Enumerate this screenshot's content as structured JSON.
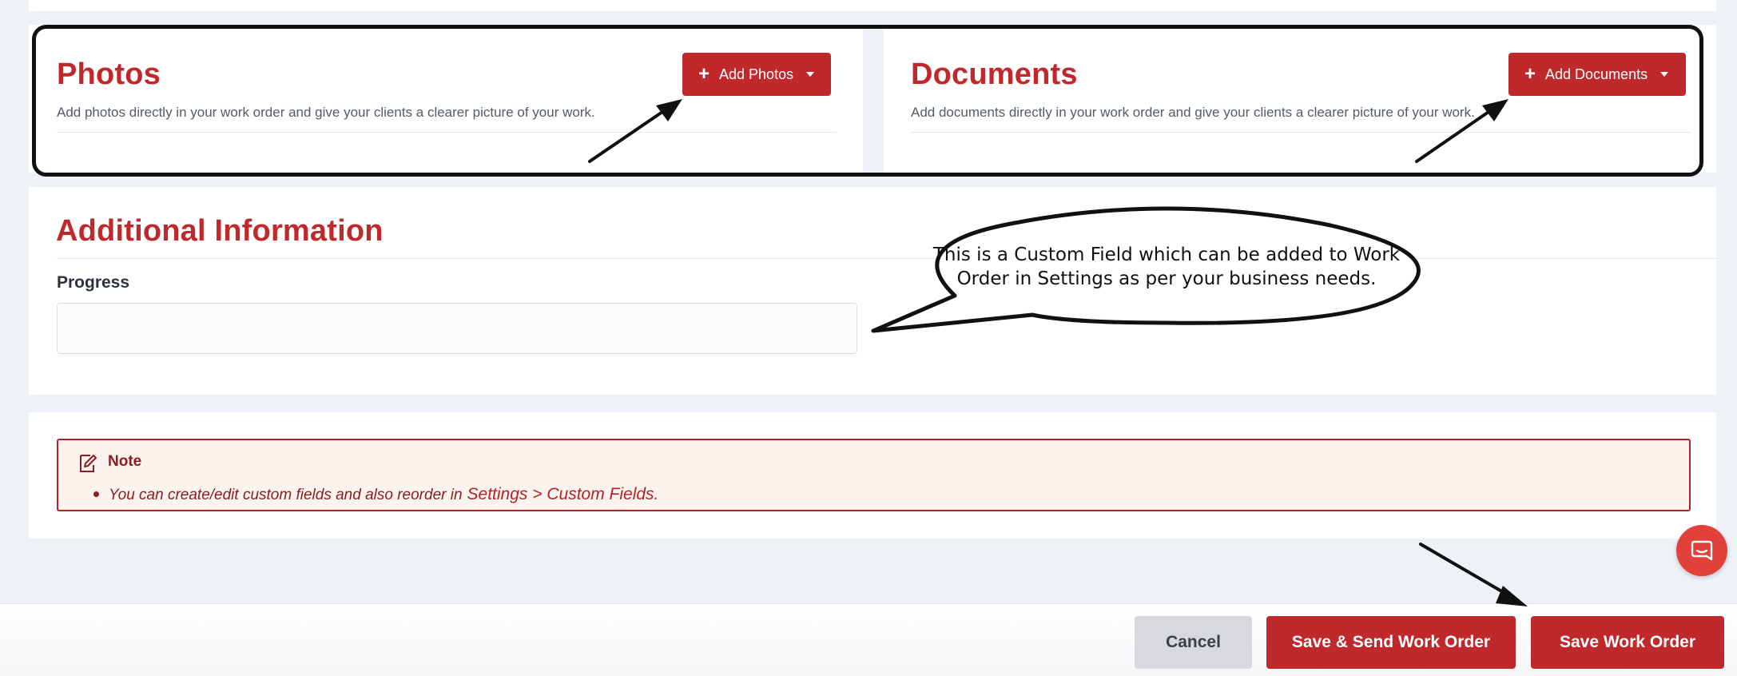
{
  "photos": {
    "title": "Photos",
    "description": "Add photos directly in your work order and give your clients a clearer picture of your work.",
    "button_label": "Add Photos"
  },
  "documents": {
    "title": "Documents",
    "description": "Add documents directly in your work order and give your clients a clearer picture of your work.",
    "button_label": "Add Documents"
  },
  "additional": {
    "title": "Additional Information",
    "progress_label": "Progress",
    "progress_value": "",
    "progress_placeholder": ""
  },
  "callout": {
    "line1": "This is a Custom Field which can be added to Work",
    "line2": "Order in Settings as per your business needs."
  },
  "note": {
    "title": "Note",
    "text": "You can create/edit custom fields and also reorder in",
    "link": "Settings > Custom Fields."
  },
  "actions": {
    "cancel": "Cancel",
    "save_send": "Save & Send Work Order",
    "save": "Save Work Order"
  },
  "colors": {
    "brand_red": "#c0292c",
    "note_bg": "#fdf3ee",
    "chat_red": "#e2403a"
  },
  "icons": {
    "add": "plus-icon",
    "dropdown": "caret-down-icon",
    "note": "edit-note-icon",
    "chat": "chat-icon"
  }
}
